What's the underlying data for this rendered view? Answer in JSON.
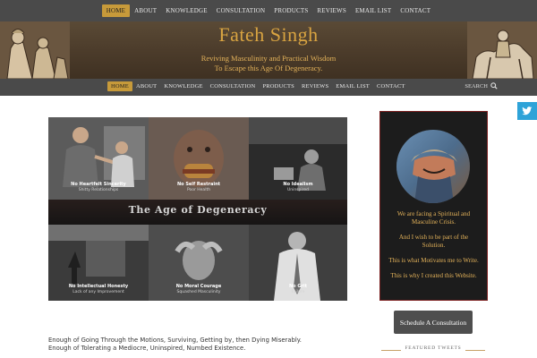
{
  "nav": {
    "items": [
      "HOME",
      "ABOUT",
      "KNOWLEDGE",
      "CONSULTATION",
      "PRODUCTS",
      "REVIEWS",
      "EMAIL LIST",
      "CONTACT"
    ],
    "active": "HOME"
  },
  "header": {
    "title": "Fateh Singh",
    "tagline_1": "Reviving Masculinity and Practical Wisdom",
    "tagline_2": "To Escape this Age Of Degeneracy."
  },
  "nav2": {
    "items": [
      "HOME",
      "ABOUT",
      "KNOWLEDGE",
      "CONSULTATION",
      "PRODUCTS",
      "REVIEWS",
      "EMAIL LIST",
      "CONTACT"
    ],
    "search_label": "SEARCH"
  },
  "social": {
    "twitter_icon": "twitter-icon"
  },
  "hero": {
    "title": "The Age of Degeneracy",
    "panels_top": [
      {
        "title": "No Heartfelt Sincerity",
        "sub": "Shitty Relationships"
      },
      {
        "title": "No Self Restraint",
        "sub": "Poor Health"
      },
      {
        "title": "No Idealism",
        "sub": "Uninspired"
      }
    ],
    "panels_bottom": [
      {
        "title": "No Intellectual Honesty",
        "sub": "Lack of any Improvement"
      },
      {
        "title": "No Moral Courage",
        "sub": "Squashed Masculinity"
      },
      {
        "title": "No Grit",
        "sub": "Failure"
      }
    ]
  },
  "sidebar": {
    "lines": [
      "We are facing a Spiritual and Masculine Crisis.",
      "And I wish to be part of the Solution.",
      "This is what Motivates me to Write.",
      "This is why I created this Website."
    ],
    "consult_button": "Schedule A Consultation",
    "featured_label": "FEATURED TWEETS"
  },
  "body": {
    "line_1": "Enough of Going Through the Motions, Surviving, Getting by, then Dying Miserably.",
    "line_2": "Enough of Tolerating a Mediocre, Uninspired, Numbed Existence."
  },
  "colors": {
    "accent": "#c79a3a",
    "gold_text": "#e3b25a",
    "nav_bg": "#4a4a4a",
    "twitter": "#2ea3d8"
  }
}
